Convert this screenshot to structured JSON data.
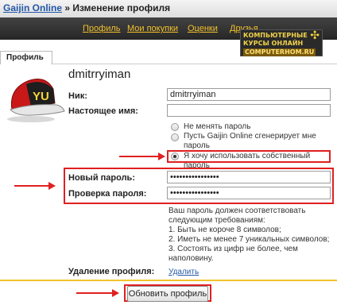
{
  "header": {
    "site_link": "Gaijin Online",
    "separator": " » ",
    "page_title": "Изменение профиля"
  },
  "nav": {
    "items": [
      "Профиль",
      "Мои покупки",
      "Оценки",
      "Друзья"
    ]
  },
  "watermark": {
    "line1": "КОМПЬЮТЕРНЫЕ",
    "line2": "КУРСЫ ОНЛАЙН",
    "line3": "COMPUTERHOM.RU"
  },
  "section": {
    "title": "Профиль"
  },
  "profile": {
    "username": "dmitrryiman",
    "avatar_text": "YU"
  },
  "form": {
    "nick_label": "Ник:",
    "nick_value": "dmitrryiman",
    "realname_label": "Настоящее имя:",
    "realname_value": "",
    "password_options": [
      {
        "label": "Не менять пароль",
        "checked": false
      },
      {
        "label": "Пусть Gaijin Online сгенерирует мне пароль",
        "checked": false
      },
      {
        "label": "Я хочу использовать собственный пароль",
        "checked": true
      }
    ],
    "new_password_label": "Новый пароль:",
    "new_password_value": "••••••••••••••••",
    "confirm_password_label": "Проверка пароля:",
    "confirm_password_value": "••••••••••••••••",
    "requirements": [
      "Ваш пароль должен соответствовать",
      "следующим требованиям:",
      "1. Быть не короче 8 символов;",
      "2. Иметь не менее 7 уникальных символов;",
      "3. Состоять из цифр не более, чем",
      "наполовину."
    ],
    "delete_label": "Удаление профиля:",
    "delete_link": "Удалить",
    "submit_label": "Обновить профиль"
  },
  "colors": {
    "nav_background": "#2f2f2f",
    "nav_link": "#f3c12c",
    "highlight": "#e02020",
    "link": "#2458a8"
  }
}
